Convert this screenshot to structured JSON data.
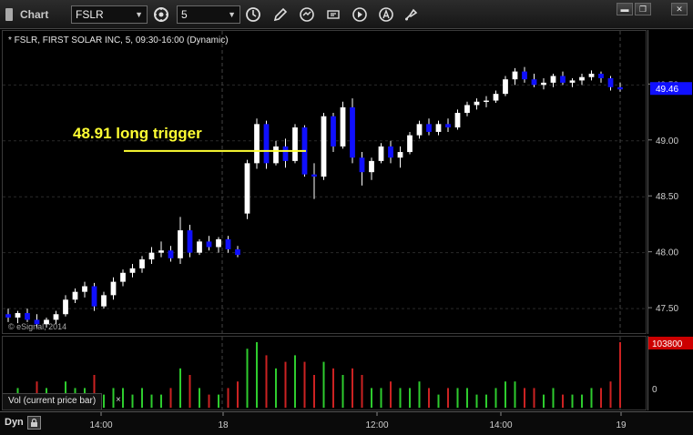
{
  "toolbar": {
    "title": "Chart",
    "symbol_value": "FSLR",
    "interval_value": "5",
    "icons": [
      "link-icon",
      "clock-icon",
      "pencil-icon",
      "refresh-icon",
      "gear-icon",
      "play-icon",
      "alert-icon",
      "draw-tool-icon"
    ]
  },
  "chart": {
    "header": "* FSLR, FIRST SOLAR INC, 5, 09:30-16:00 (Dynamic)",
    "copyright": "© eSignal, 2014",
    "annotation": "48.91 long trigger",
    "annotation_color": "#ffff33",
    "up_color": "#ffffff",
    "down_color": "#1010ff",
    "last_price_label": "49.46",
    "last_price_bg": "#1010ff"
  },
  "volume": {
    "legend": "Vol (current price bar)",
    "close_symbol": "×",
    "last_volume_label": "103800",
    "last_volume_bg": "#cc0000",
    "zero_label": "0",
    "up_color": "#2ecc2e",
    "down_color": "#cc2222"
  },
  "footer": {
    "mode_label": "Dyn",
    "lock_symbol": "🔒",
    "time_labels": [
      "14:00",
      "18",
      "12:00",
      "14:00",
      "19"
    ]
  },
  "chart_data": {
    "type": "candlestick",
    "y_ticks": [
      "49.50",
      "49.00",
      "48.50",
      "48.00",
      "47.50"
    ],
    "ylim": [
      47.33,
      49.82
    ],
    "trigger_level": 48.91,
    "annotation": "48.91 long trigger",
    "last_price": 49.46,
    "candles_approx": [
      {
        "o": 47.45,
        "h": 47.5,
        "l": 47.38,
        "c": 47.42,
        "v": 2
      },
      {
        "o": 47.42,
        "h": 47.48,
        "l": 47.37,
        "c": 47.46,
        "v": 3
      },
      {
        "o": 47.46,
        "h": 47.5,
        "l": 47.38,
        "c": 47.4,
        "v": 2
      },
      {
        "o": 47.4,
        "h": 47.45,
        "l": 47.33,
        "c": 47.36,
        "v": 4
      },
      {
        "o": 47.36,
        "h": 47.42,
        "l": 47.33,
        "c": 47.4,
        "v": 3
      },
      {
        "o": 47.4,
        "h": 47.48,
        "l": 47.36,
        "c": 47.45,
        "v": 2
      },
      {
        "o": 47.45,
        "h": 47.62,
        "l": 47.43,
        "c": 47.58,
        "v": 4
      },
      {
        "o": 47.58,
        "h": 47.68,
        "l": 47.55,
        "c": 47.65,
        "v": 3
      },
      {
        "o": 47.65,
        "h": 47.74,
        "l": 47.6,
        "c": 47.7,
        "v": 3
      },
      {
        "o": 47.7,
        "h": 47.73,
        "l": 47.48,
        "c": 47.52,
        "v": 5
      },
      {
        "o": 47.52,
        "h": 47.65,
        "l": 47.5,
        "c": 47.62,
        "v": 2
      },
      {
        "o": 47.62,
        "h": 47.78,
        "l": 47.58,
        "c": 47.74,
        "v": 3
      },
      {
        "o": 47.74,
        "h": 47.85,
        "l": 47.7,
        "c": 47.82,
        "v": 3
      },
      {
        "o": 47.82,
        "h": 47.9,
        "l": 47.78,
        "c": 47.86,
        "v": 2
      },
      {
        "o": 47.86,
        "h": 47.97,
        "l": 47.82,
        "c": 47.94,
        "v": 3
      },
      {
        "o": 47.94,
        "h": 48.05,
        "l": 47.9,
        "c": 48.0,
        "v": 2
      },
      {
        "o": 48.0,
        "h": 48.1,
        "l": 47.96,
        "c": 48.02,
        "v": 2
      },
      {
        "o": 48.02,
        "h": 48.06,
        "l": 47.92,
        "c": 47.95,
        "v": 3
      },
      {
        "o": 47.95,
        "h": 48.32,
        "l": 47.9,
        "c": 48.2,
        "v": 6
      },
      {
        "o": 48.2,
        "h": 48.25,
        "l": 47.96,
        "c": 48.0,
        "v": 5
      },
      {
        "o": 48.0,
        "h": 48.12,
        "l": 47.98,
        "c": 48.1,
        "v": 3
      },
      {
        "o": 48.1,
        "h": 48.15,
        "l": 48.02,
        "c": 48.05,
        "v": 2
      },
      {
        "o": 48.05,
        "h": 48.14,
        "l": 48.0,
        "c": 48.12,
        "v": 2
      },
      {
        "o": 48.12,
        "h": 48.15,
        "l": 48.0,
        "c": 48.03,
        "v": 3
      },
      {
        "o": 48.03,
        "h": 48.06,
        "l": 47.96,
        "c": 47.98,
        "v": 4
      },
      {
        "o": 48.35,
        "h": 48.83,
        "l": 48.3,
        "c": 48.8,
        "v": 9
      },
      {
        "o": 48.8,
        "h": 49.2,
        "l": 48.75,
        "c": 49.15,
        "v": 10
      },
      {
        "o": 49.15,
        "h": 49.18,
        "l": 48.75,
        "c": 48.8,
        "v": 8
      },
      {
        "o": 48.8,
        "h": 49.0,
        "l": 48.78,
        "c": 48.95,
        "v": 6
      },
      {
        "o": 48.95,
        "h": 49.02,
        "l": 48.76,
        "c": 48.82,
        "v": 7
      },
      {
        "o": 48.82,
        "h": 49.15,
        "l": 48.8,
        "c": 49.12,
        "v": 8
      },
      {
        "o": 49.12,
        "h": 49.14,
        "l": 48.68,
        "c": 48.7,
        "v": 7
      },
      {
        "o": 48.7,
        "h": 48.8,
        "l": 48.48,
        "c": 48.68,
        "v": 5
      },
      {
        "o": 48.68,
        "h": 49.25,
        "l": 48.65,
        "c": 49.22,
        "v": 7
      },
      {
        "o": 49.22,
        "h": 49.25,
        "l": 48.9,
        "c": 48.95,
        "v": 6
      },
      {
        "o": 48.95,
        "h": 49.35,
        "l": 48.93,
        "c": 49.3,
        "v": 5
      },
      {
        "o": 49.3,
        "h": 49.38,
        "l": 48.8,
        "c": 48.85,
        "v": 6
      },
      {
        "o": 48.85,
        "h": 48.9,
        "l": 48.6,
        "c": 48.72,
        "v": 5
      },
      {
        "o": 48.72,
        "h": 48.85,
        "l": 48.65,
        "c": 48.82,
        "v": 3
      },
      {
        "o": 48.82,
        "h": 48.98,
        "l": 48.8,
        "c": 48.95,
        "v": 3
      },
      {
        "o": 48.95,
        "h": 49.0,
        "l": 48.8,
        "c": 48.85,
        "v": 4
      },
      {
        "o": 48.85,
        "h": 48.95,
        "l": 48.76,
        "c": 48.9,
        "v": 3
      },
      {
        "o": 48.9,
        "h": 49.08,
        "l": 48.88,
        "c": 49.05,
        "v": 3
      },
      {
        "o": 49.05,
        "h": 49.18,
        "l": 49.02,
        "c": 49.15,
        "v": 4
      },
      {
        "o": 49.15,
        "h": 49.2,
        "l": 49.05,
        "c": 49.08,
        "v": 3
      },
      {
        "o": 49.08,
        "h": 49.18,
        "l": 49.05,
        "c": 49.15,
        "v": 2
      },
      {
        "o": 49.15,
        "h": 49.2,
        "l": 49.08,
        "c": 49.12,
        "v": 3
      },
      {
        "o": 49.12,
        "h": 49.28,
        "l": 49.1,
        "c": 49.25,
        "v": 3
      },
      {
        "o": 49.25,
        "h": 49.35,
        "l": 49.22,
        "c": 49.32,
        "v": 3
      },
      {
        "o": 49.32,
        "h": 49.38,
        "l": 49.28,
        "c": 49.35,
        "v": 2
      },
      {
        "o": 49.35,
        "h": 49.4,
        "l": 49.3,
        "c": 49.36,
        "v": 2
      },
      {
        "o": 49.36,
        "h": 49.45,
        "l": 49.34,
        "c": 49.42,
        "v": 3
      },
      {
        "o": 49.42,
        "h": 49.58,
        "l": 49.4,
        "c": 49.55,
        "v": 4
      },
      {
        "o": 49.55,
        "h": 49.65,
        "l": 49.5,
        "c": 49.62,
        "v": 4
      },
      {
        "o": 49.62,
        "h": 49.66,
        "l": 49.52,
        "c": 49.55,
        "v": 3
      },
      {
        "o": 49.55,
        "h": 49.6,
        "l": 49.48,
        "c": 49.5,
        "v": 3
      },
      {
        "o": 49.5,
        "h": 49.56,
        "l": 49.46,
        "c": 49.52,
        "v": 2
      },
      {
        "o": 49.52,
        "h": 49.6,
        "l": 49.48,
        "c": 49.58,
        "v": 3
      },
      {
        "o": 49.58,
        "h": 49.62,
        "l": 49.5,
        "c": 49.52,
        "v": 2
      },
      {
        "o": 49.52,
        "h": 49.56,
        "l": 49.48,
        "c": 49.54,
        "v": 2
      },
      {
        "o": 49.54,
        "h": 49.6,
        "l": 49.5,
        "c": 49.57,
        "v": 2
      },
      {
        "o": 49.57,
        "h": 49.63,
        "l": 49.54,
        "c": 49.6,
        "v": 3
      },
      {
        "o": 49.6,
        "h": 49.62,
        "l": 49.52,
        "c": 49.56,
        "v": 3
      },
      {
        "o": 49.56,
        "h": 49.58,
        "l": 49.45,
        "c": 49.48,
        "v": 4
      },
      {
        "o": 49.48,
        "h": 49.52,
        "l": 49.44,
        "c": 49.46,
        "v": 10
      }
    ]
  }
}
